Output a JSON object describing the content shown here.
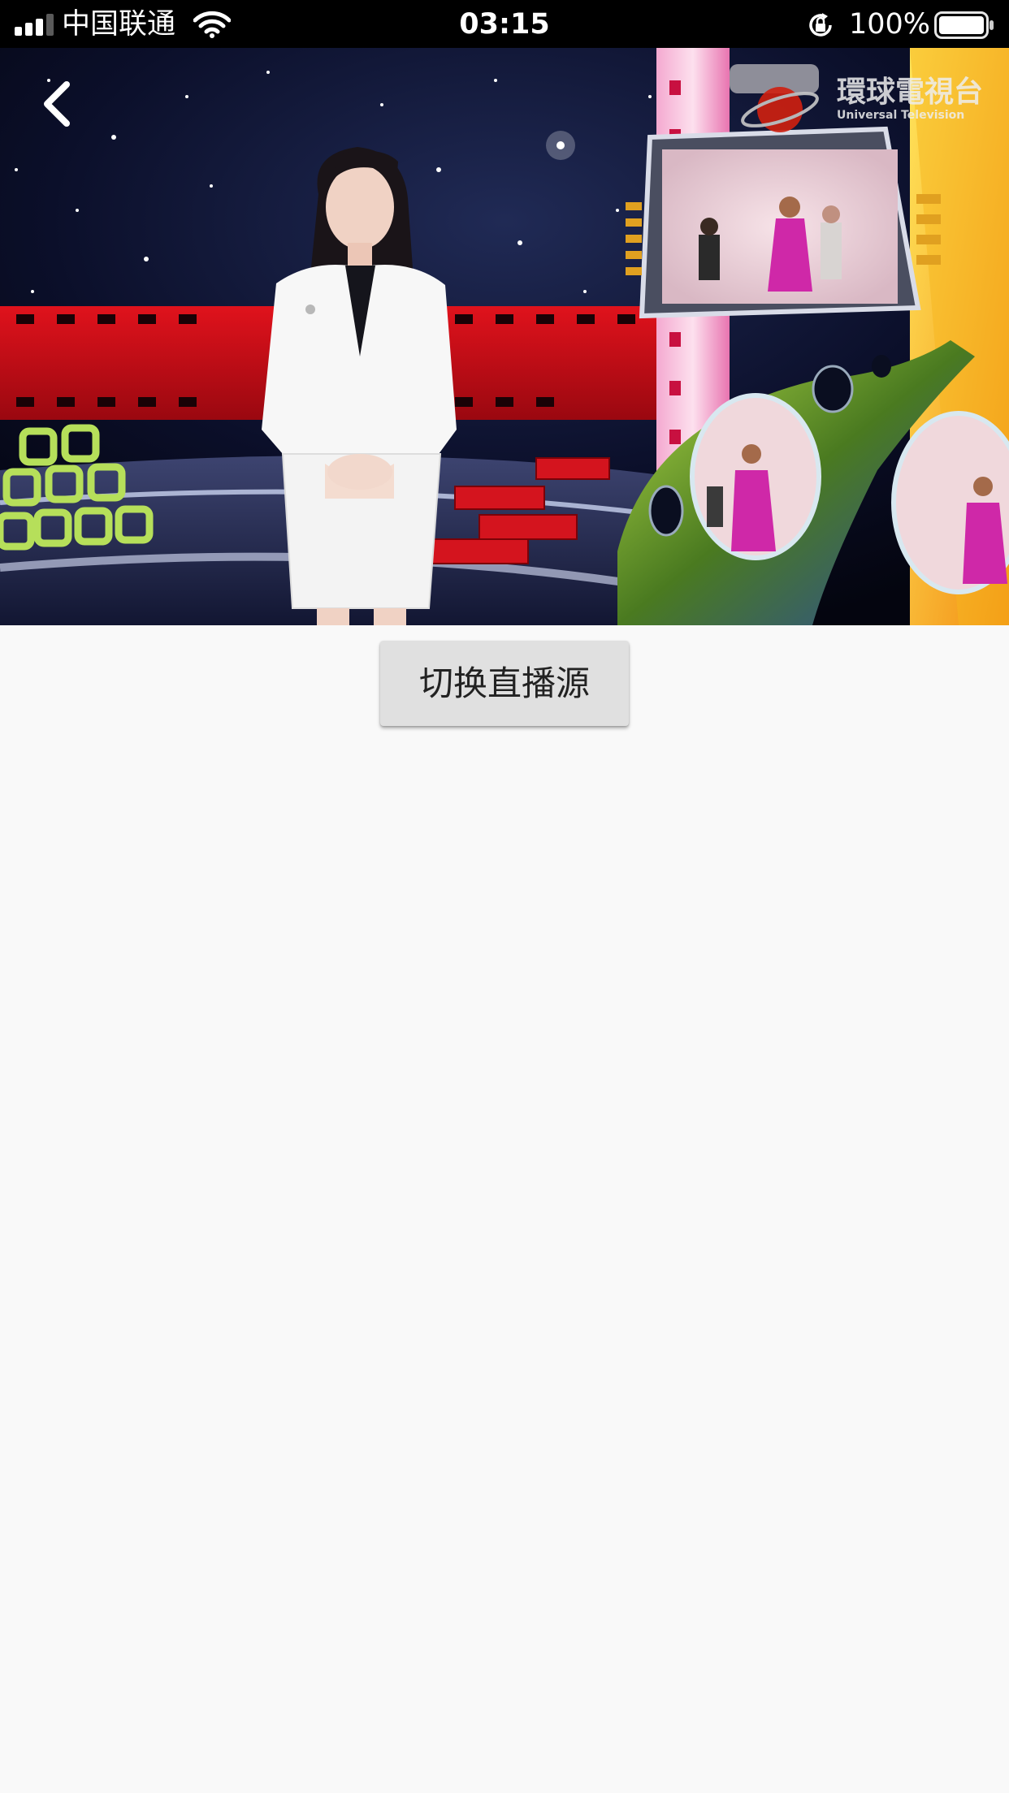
{
  "status_bar": {
    "carrier": "中国联通",
    "time": "03:15",
    "battery_percent": "100%",
    "battery_level": 1.0,
    "signal_bars_filled": 3,
    "signal_bars_total": 4,
    "icons": [
      "signal-icon",
      "wifi-icon",
      "rotation-lock-icon",
      "battery-icon"
    ]
  },
  "player": {
    "back_icon": "chevron-left-icon",
    "watermark_text": "環球電視台",
    "watermark_subtext": "Universal Television"
  },
  "actions": {
    "switch_source_label": "切换直播源"
  },
  "colors": {
    "status_bar_bg": "#000000",
    "page_bg": "#f9f9f9",
    "button_bg": "#e0e0e0",
    "button_text": "#222222"
  }
}
